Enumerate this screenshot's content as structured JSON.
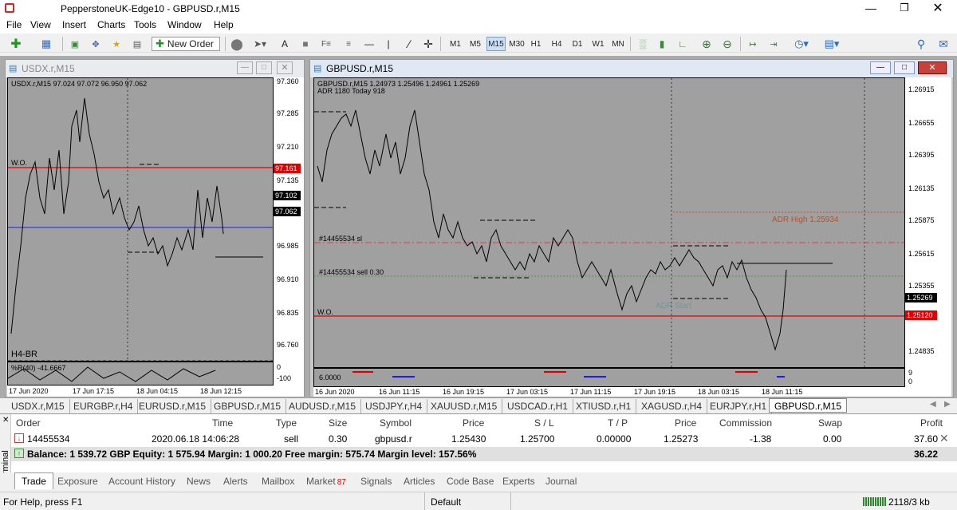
{
  "window": {
    "title": "PepperstoneUK-Edge10 - GBPUSD.r,M15"
  },
  "menu": [
    "File",
    "View",
    "Insert",
    "Charts",
    "Tools",
    "Window",
    "Help"
  ],
  "toolbar": {
    "new_order_label": "New Order",
    "timeframes": [
      "M1",
      "M5",
      "M15",
      "M30",
      "H1",
      "H4",
      "D1",
      "W1",
      "MN"
    ],
    "active_timeframe": "M15"
  },
  "charts": {
    "usdx": {
      "window_title": "USDX.r,M15",
      "info": "USDX.r,M15  97.024 97.072 96.950 97.062",
      "price_labels": [
        "97.360",
        "97.285",
        "97.210",
        "97.135",
        "96.985",
        "96.910",
        "96.835",
        "96.760"
      ],
      "badges": [
        {
          "text": "97.161",
          "color": "#e00000"
        },
        {
          "text": "97.102",
          "color": "#000000"
        },
        {
          "text": "97.062",
          "color": "#000000"
        }
      ],
      "wo_label": "W.O.",
      "indicator_label": "H4-BR",
      "indicator_info": "%R(40) -41.6667",
      "ind_axis": [
        "0",
        "-100"
      ],
      "time_labels": [
        "17 Jun 2020",
        "17 Jun 17:15",
        "18 Jun 04:15",
        "18 Jun 12:15"
      ]
    },
    "gbpusd": {
      "window_title": "GBPUSD.r,M15",
      "info": "GBPUSD.r,M15  1.24973 1.25496 1.24961 1.25269",
      "adr_info": "ADR 1180  Today 918",
      "price_labels": [
        "1.26915",
        "1.26655",
        "1.26395",
        "1.26135",
        "1.25875",
        "1.25615",
        "1.25355",
        "1.24835"
      ],
      "badges": [
        {
          "text": "1.25269",
          "color": "#000000"
        },
        {
          "text": "1.25120",
          "color": "#e00000"
        }
      ],
      "sl_label": "#14455534 sl",
      "entry_label": "#14455534 sell 0.30",
      "wo_label": "W.O.",
      "adr_high_label": "ADR High  1.25934",
      "adr_start_label": "ADR Start",
      "sub_value": "6.0000",
      "sub_axis": [
        "9",
        "0"
      ],
      "time_labels": [
        "16 Jun 2020",
        "16 Jun 11:15",
        "16 Jun 19:15",
        "17 Jun 03:15",
        "17 Jun 11:15",
        "17 Jun 19:15",
        "18 Jun 03:15",
        "18 Jun 11:15"
      ]
    }
  },
  "chart_tabs": [
    "USDX.r,M15",
    "EURGBP.r,H4",
    "EURUSD.r,M15",
    "GBPUSD.r,M15",
    "AUDUSD.r,M15",
    "USDJPY.r,H4",
    "XAUUSD.r,M15",
    "USDCAD.r,H1",
    "XTIUSD.r,H1",
    "XAGUSD.r,H4",
    "EURJPY.r,H1",
    "GBPUSD.r,M15"
  ],
  "terminal": {
    "label": "Terminal",
    "headers": [
      "Order",
      "Time",
      "Type",
      "Size",
      "Symbol",
      "Price",
      "S / L",
      "T / P",
      "Price",
      "Commission",
      "Swap",
      "Profit"
    ],
    "row": [
      "14455534",
      "2020.06.18 14:06:28",
      "sell",
      "0.30",
      "gbpusd.r",
      "1.25430",
      "1.25700",
      "0.00000",
      "1.25273",
      "-1.38",
      "0.00",
      "37.60"
    ],
    "balance_line": "Balance: 1 539.72 GBP  Equity: 1 575.94  Margin: 1 000.20  Free margin: 575.74  Margin level: 157.56%",
    "total_profit": "36.22",
    "tabs": [
      "Trade",
      "Exposure",
      "Account History",
      "News",
      "Alerts",
      "Mailbox",
      "Market",
      "Signals",
      "Articles",
      "Code Base",
      "Experts",
      "Journal"
    ],
    "market_badge": "87"
  },
  "status": {
    "help": "For Help, press F1",
    "profile": "Default",
    "traffic": "2118/3 kb"
  },
  "colors": {
    "red_line": "#e00000",
    "blue_line": "#1a1aff",
    "adr_high": "#c05020",
    "adr_start": "#6a9aa0"
  }
}
